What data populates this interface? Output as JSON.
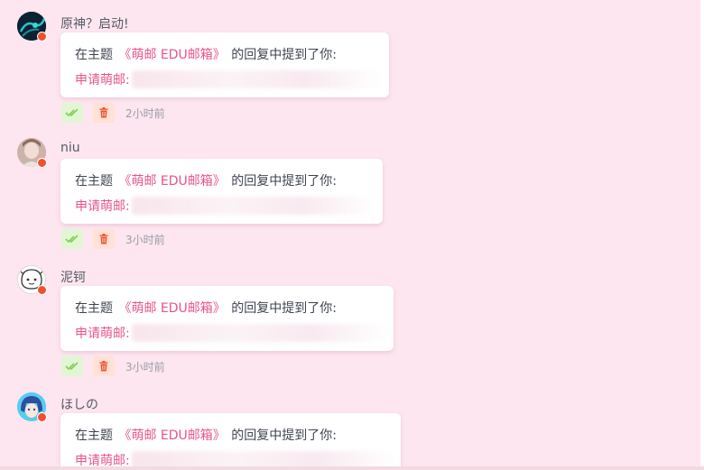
{
  "notifications": [
    {
      "username": "原神？启动!",
      "avatar": "dark-anime-avatar",
      "prefix": "在主题",
      "topic": "《萌邮 EDU邮箱》",
      "suffix": "的回复中提到了你:",
      "label": "申请萌邮:",
      "time": "2小时前"
    },
    {
      "username": "niu",
      "avatar": "photo-avatar",
      "prefix": "在主题",
      "topic": "《萌邮 EDU邮箱》",
      "suffix": "的回复中提到了你:",
      "label": "申请萌邮:",
      "time": "3小时前"
    },
    {
      "username": "泥钶",
      "avatar": "sketch-face-avatar",
      "prefix": "在主题",
      "topic": "《萌邮 EDU邮箱》",
      "suffix": "的回复中提到了你:",
      "label": "申请萌邮:",
      "time": "3小时前"
    },
    {
      "username": "ほしの",
      "avatar": "blue-hair-anime-avatar",
      "prefix": "在主题",
      "topic": "《萌邮 EDU邮箱》",
      "suffix": "的回复中提到了你:",
      "label": "申请萌邮:",
      "time": ""
    }
  ],
  "icons": {
    "mark_read": "double-check-icon",
    "delete": "trash-icon",
    "status": "online-dot"
  },
  "colors": {
    "background": "#fde6ef",
    "topic_link": "#e8538a",
    "mark_read_bg": "#e2f6d4",
    "mark_read_icon": "#7fcf54",
    "delete_bg": "#ffe1d6",
    "delete_icon": "#f0502d",
    "status_dot": "#f0502d"
  }
}
